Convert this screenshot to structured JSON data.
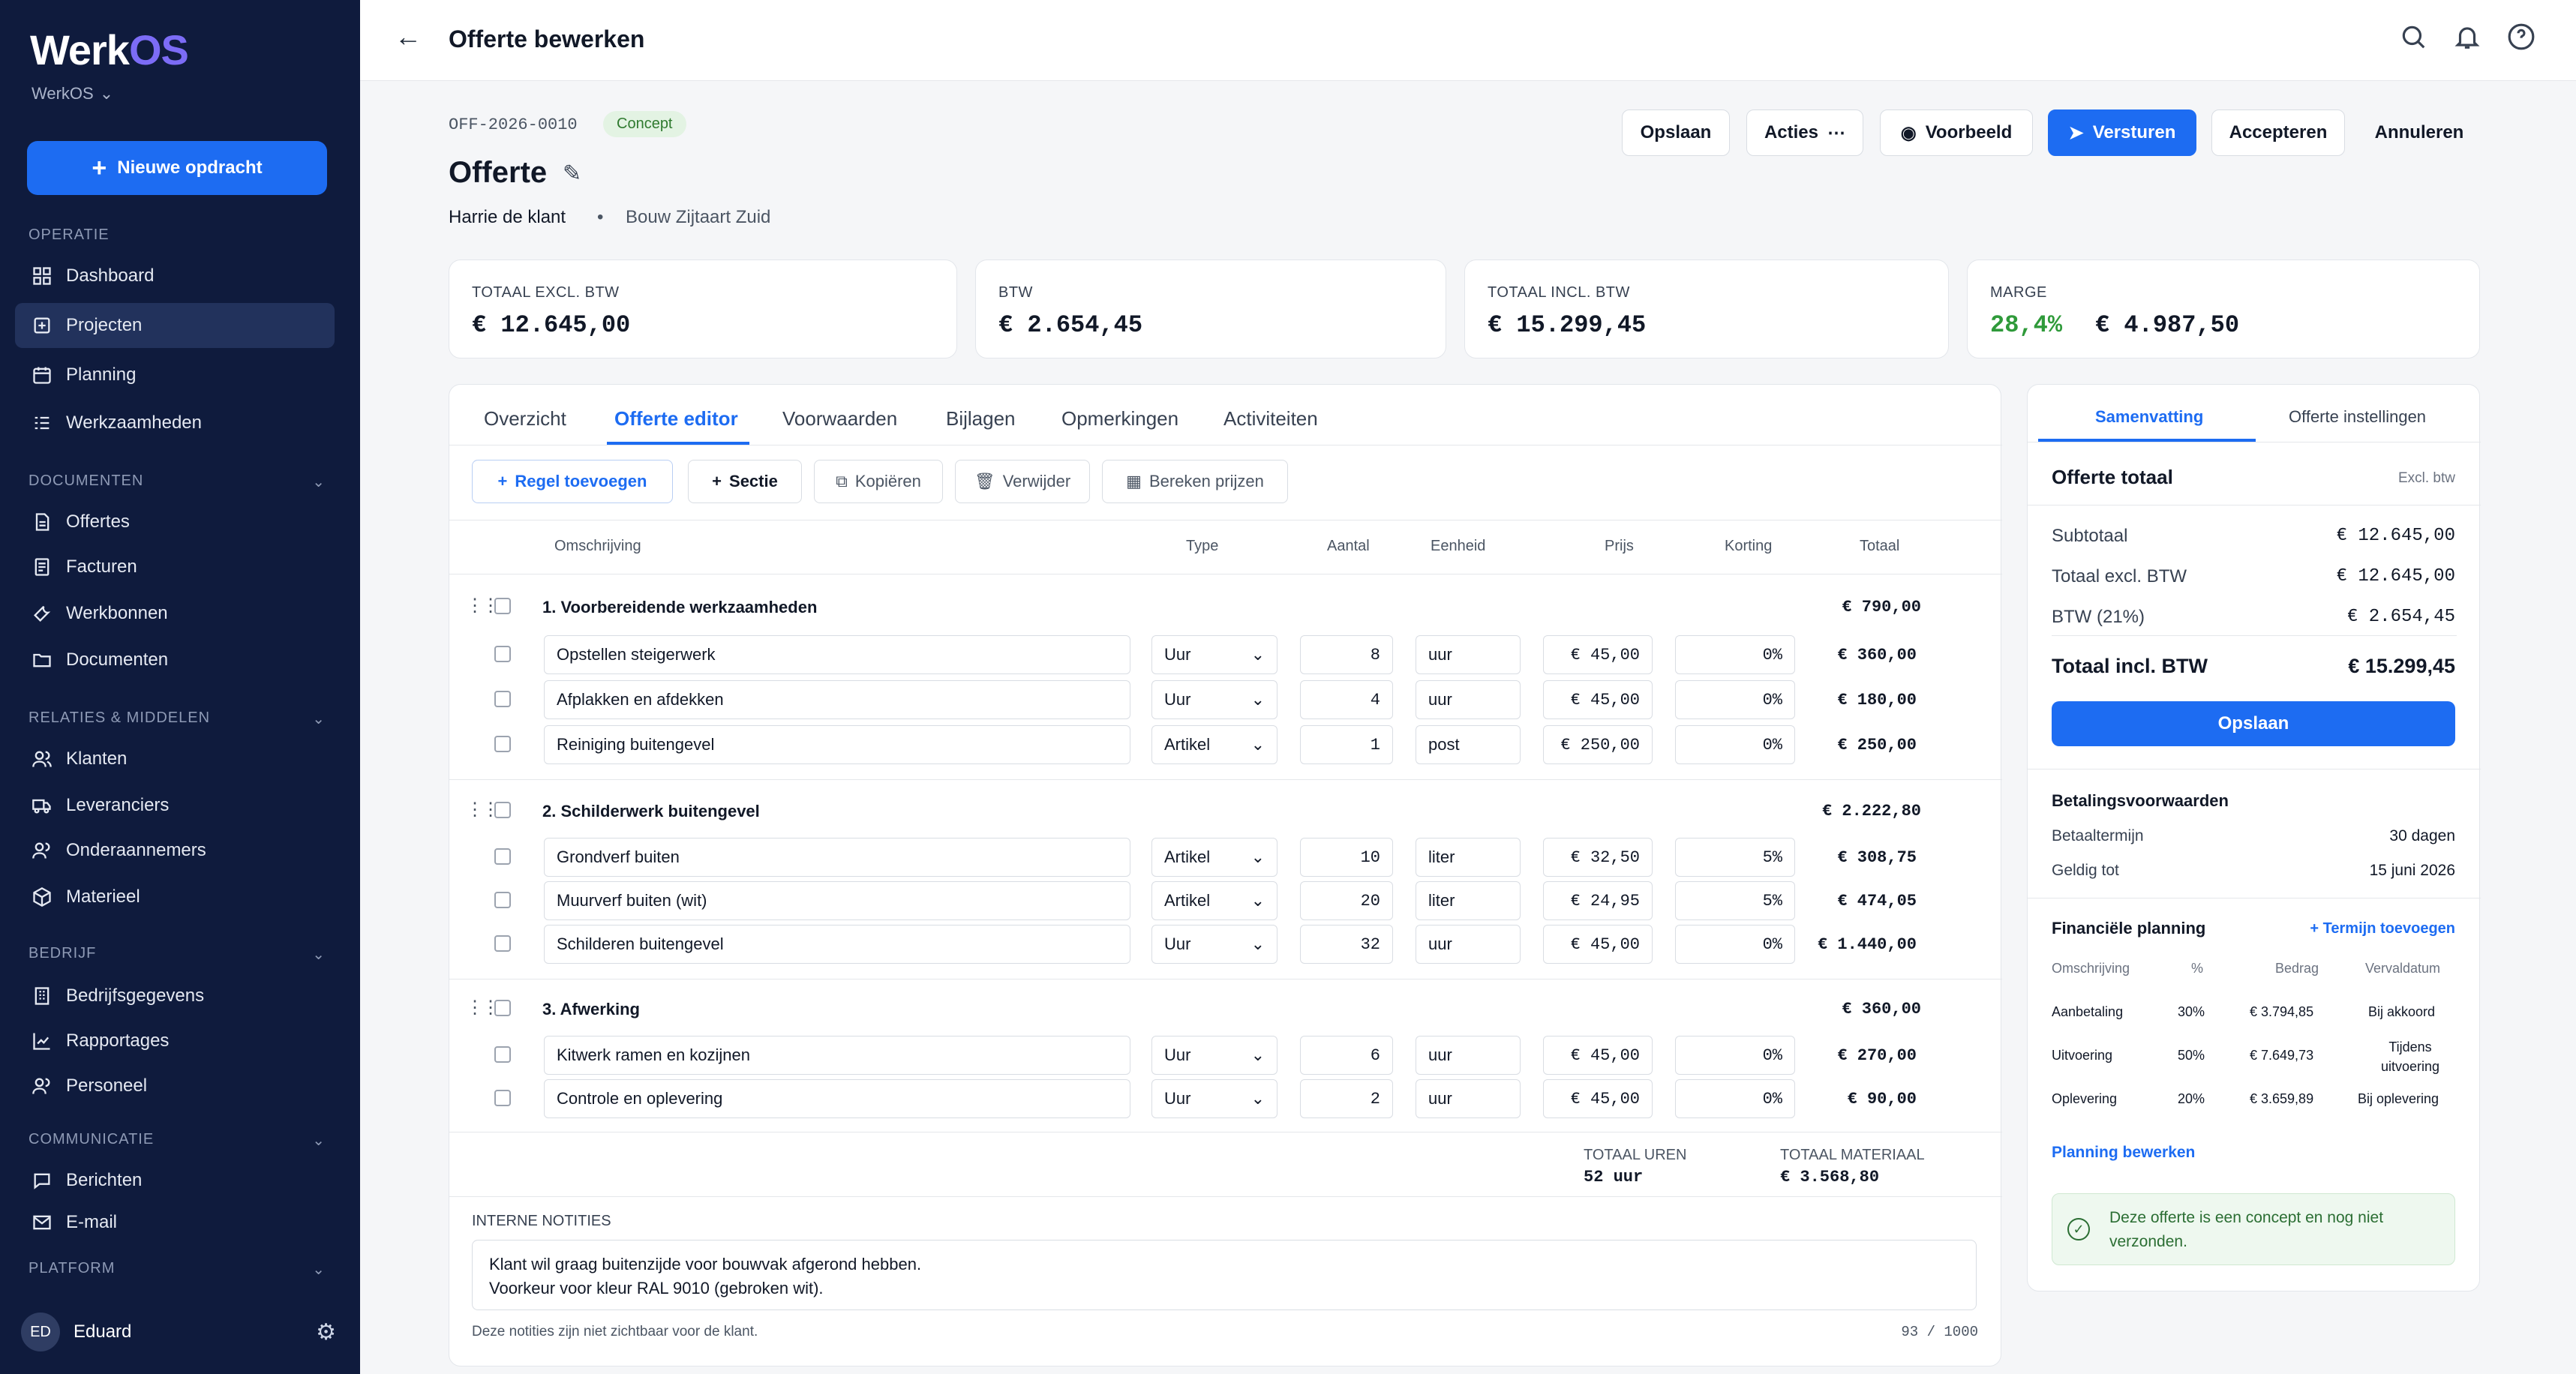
{
  "sidebar": {
    "logo_main": "Werk",
    "logo_accent": "OS",
    "workspace": "WerkOS",
    "new_button": "Nieuwe opdracht",
    "sections": [
      {
        "title": "OPERATIE",
        "items": [
          "Dashboard",
          "Projecten",
          "Planning",
          "Werkzaamheden"
        ]
      },
      {
        "title": "DOCUMENTEN",
        "items": [
          "Offertes",
          "Facturen",
          "Werkbonnen",
          "Documenten"
        ]
      },
      {
        "title": "RELATIES & MIDDELEN",
        "items": [
          "Klanten",
          "Leveranciers",
          "Onderaannemers",
          "Materieel"
        ]
      },
      {
        "title": "BEDRIJF",
        "items": [
          "Bedrijfsgegevens",
          "Rapportages",
          "Personeel"
        ]
      },
      {
        "title": "COMMUNICATIE",
        "items": [
          "Berichten",
          "E-mail"
        ]
      },
      {
        "title": "PLATFORM",
        "items": []
      }
    ],
    "active_item": "Projecten",
    "user_initials": "ED",
    "user_name": "Eduard",
    "accent_color": "#1d6cf2"
  },
  "topbar": {
    "title": "Offerte bewerken"
  },
  "quote": {
    "number": "OFF-2026-0010",
    "status": "Concept",
    "title": "Offerte",
    "customer": "Harrie de klant",
    "separator": "•",
    "project": "Bouw Zijtaart Zuid"
  },
  "actions": {
    "save": "Opslaan",
    "actions": "Acties",
    "preview": "Voorbeeld",
    "send": "Versturen",
    "accept": "Accepteren",
    "cancel": "Annuleren"
  },
  "summary_cards": [
    {
      "label": "TOTAAL EXCL. BTW",
      "value": "€ 12.645,00"
    },
    {
      "label": "BTW",
      "value": "€ 2.654,45"
    },
    {
      "label": "TOTAAL INCL. BTW",
      "value": "€ 15.299,45"
    },
    {
      "label": "MARGE",
      "percent": "28,4%",
      "value": "€ 4.987,50"
    }
  ],
  "tabs": [
    "Overzicht",
    "Offerte editor",
    "Voorwaarden",
    "Bijlagen",
    "Opmerkingen",
    "Activiteiten"
  ],
  "active_tab": "Offerte editor",
  "toolbar": {
    "add_line": "Regel toevoegen",
    "section": "Sectie",
    "copy": "Kopiëren",
    "delete": "Verwijder",
    "calc": "Bereken prijzen"
  },
  "columns": {
    "desc": "Omschrijving",
    "type": "Type",
    "qty": "Aantal",
    "unit": "Eenheid",
    "price": "Prijs",
    "discount": "Korting",
    "total": "Totaal"
  },
  "groups": [
    {
      "title": "1. Voorbereidende werkzaamheden",
      "total": "€ 790,00",
      "rows": [
        {
          "desc": "Opstellen steigerwerk",
          "type": "Uur",
          "qty": "8",
          "unit": "uur",
          "price": "€ 45,00",
          "discount": "0%",
          "total": "€ 360,00"
        },
        {
          "desc": "Afplakken en afdekken",
          "type": "Uur",
          "qty": "4",
          "unit": "uur",
          "price": "€ 45,00",
          "discount": "0%",
          "total": "€ 180,00"
        },
        {
          "desc": "Reiniging buitengevel",
          "type": "Artikel",
          "qty": "1",
          "unit": "post",
          "price": "€ 250,00",
          "discount": "0%",
          "total": "€ 250,00"
        }
      ]
    },
    {
      "title": "2. Schilderwerk buitengevel",
      "total": "€ 2.222,80",
      "rows": [
        {
          "desc": "Grondverf buiten",
          "type": "Artikel",
          "qty": "10",
          "unit": "liter",
          "price": "€ 32,50",
          "discount": "5%",
          "total": "€ 308,75"
        },
        {
          "desc": "Muurverf buiten (wit)",
          "type": "Artikel",
          "qty": "20",
          "unit": "liter",
          "price": "€ 24,95",
          "discount": "5%",
          "total": "€ 474,05"
        },
        {
          "desc": "Schilderen buitengevel",
          "type": "Uur",
          "qty": "32",
          "unit": "uur",
          "price": "€ 45,00",
          "discount": "0%",
          "total": "€ 1.440,00"
        }
      ]
    },
    {
      "title": "3. Afwerking",
      "total": "€ 360,00",
      "rows": [
        {
          "desc": "Kitwerk ramen en kozijnen",
          "type": "Uur",
          "qty": "6",
          "unit": "uur",
          "price": "€ 45,00",
          "discount": "0%",
          "total": "€ 270,00"
        },
        {
          "desc": "Controle en oplevering",
          "type": "Uur",
          "qty": "2",
          "unit": "uur",
          "price": "€ 45,00",
          "discount": "0%",
          "total": "€ 90,00"
        }
      ]
    }
  ],
  "footer": {
    "hours_label": "TOTAAL UREN",
    "hours_value": "52 uur",
    "material_label": "TOTAAL MATERIAAL",
    "material_value": "€ 3.568,80"
  },
  "notes": {
    "label": "INTERNE NOTITIES",
    "line1": "Klant wil graag buitenzijde voor bouwvak afgerond hebben.",
    "line2": "Voorkeur voor kleur RAL 9010 (gebroken wit).",
    "hint": "Deze notities zijn niet zichtbaar voor de klant.",
    "counter": "93 / 1000"
  },
  "side": {
    "tabs": [
      "Samenvatting",
      "Offerte instellingen"
    ],
    "total_title": "Offerte totaal",
    "total_note": "Excl. btw",
    "rows": [
      {
        "label": "Subtotaal",
        "value": "€ 12.645,00"
      },
      {
        "label": "Totaal excl. BTW",
        "value": "€ 12.645,00"
      },
      {
        "label": "BTW (21%)",
        "value": "€ 2.654,45"
      }
    ],
    "grand_label": "Totaal incl. BTW",
    "grand_value": "€ 15.299,45",
    "save": "Opslaan",
    "payment_title": "Betalingsvoorwaarden",
    "term_label": "Betaaltermijn",
    "term_value": "30 dagen",
    "valid_label": "Geldig tot",
    "valid_value": "15 juni 2026",
    "plan_title": "Financiële planning",
    "plan_add": "Termijn toevoegen",
    "plan_cols": [
      "Omschrijving",
      "%",
      "Bedrag",
      "Vervaldatum"
    ],
    "plan_rows": [
      {
        "desc": "Aanbetaling",
        "pct": "30%",
        "amount": "€ 3.794,85",
        "due": "Bij akkoord"
      },
      {
        "desc": "Uitvoering",
        "pct": "50%",
        "amount": "€ 7.649,73",
        "due": "Tijdens uitvoering"
      },
      {
        "desc": "Oplevering",
        "pct": "20%",
        "amount": "€ 3.659,89",
        "due": "Bij oplevering"
      }
    ],
    "plan_edit": "Planning bewerken",
    "info": "Deze offerte is een concept en nog niet verzonden."
  }
}
